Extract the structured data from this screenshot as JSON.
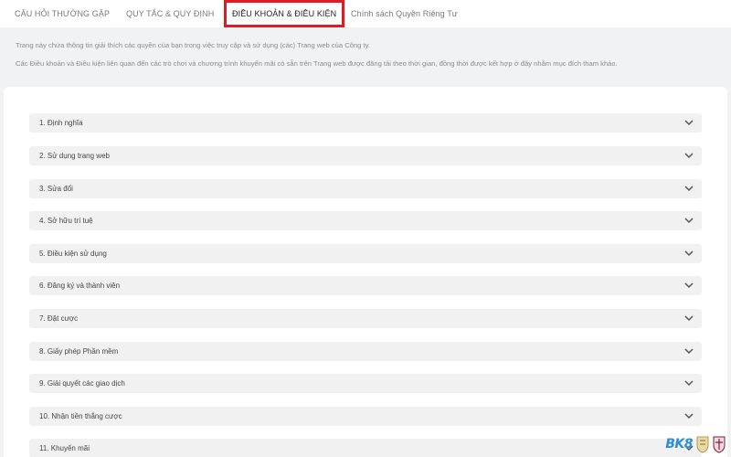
{
  "tabs": [
    {
      "label": "CÂU HỎI THƯỜNG GẶP",
      "active": false
    },
    {
      "label": "QUY TẮC & QUY ĐỊNH",
      "active": false
    },
    {
      "label": "ĐIỀU KHOẢN & ĐIỀU KIỆN",
      "active": true
    },
    {
      "label": "Chính sách Quyền Riêng Tư",
      "active": false
    }
  ],
  "intro": {
    "line1": "Trang này chứa thông tin giải thích các quyền của bạn trong việc truy cập và sử dụng (các) Trang web của Công ty.",
    "line2": "Các Điều khoản và Điều kiện liên quan đến các trò chơi và chương trình khuyến mãi có sẵn trên Trang web được đăng tải theo thời gian, đồng thời được kết hợp ở đây nhằm mục đích tham khảo."
  },
  "accordion": [
    {
      "label": "1. Định nghĩa"
    },
    {
      "label": "2. Sử dụng trang web"
    },
    {
      "label": "3. Sửa đổi"
    },
    {
      "label": "4. Sở hữu trí tuệ"
    },
    {
      "label": "5. Điều kiện sử dụng"
    },
    {
      "label": "6. Đăng ký và thành viên"
    },
    {
      "label": "7. Đặt cược"
    },
    {
      "label": "8. Giấy phép Phần mềm"
    },
    {
      "label": "9. Giải quyết các giao dịch"
    },
    {
      "label": "10. Nhận tiền thắng cược"
    },
    {
      "label": "11. Khuyến mãi"
    }
  ],
  "footer": {
    "brand": "BK8",
    "icons": [
      "crest-gold-icon",
      "crest-claret-icon"
    ]
  },
  "colors": {
    "active_tab_border": "#e01b24",
    "page_bg": "#f1f2f4",
    "panel_bg": "#ffffff",
    "item_bg": "#f1f1f2",
    "brand": "#2a8fd6"
  }
}
